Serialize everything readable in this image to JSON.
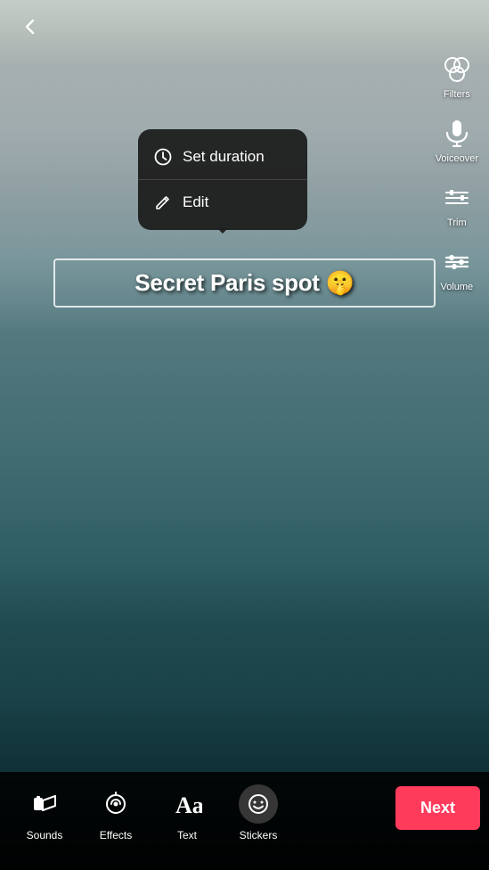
{
  "video": {
    "alt": "Paris river video background"
  },
  "top_bar": {
    "back_label": "‹"
  },
  "right_toolbar": {
    "items": [
      {
        "id": "filters",
        "label": "Filters",
        "icon": "filters"
      },
      {
        "id": "voiceover",
        "label": "Voiceover",
        "icon": "mic"
      },
      {
        "id": "trim",
        "label": "Trim",
        "icon": "trim"
      },
      {
        "id": "volume",
        "label": "Volume",
        "icon": "sliders"
      }
    ]
  },
  "context_menu": {
    "items": [
      {
        "id": "set-duration",
        "label": "Set duration",
        "icon": "clock"
      },
      {
        "id": "edit",
        "label": "Edit",
        "icon": "edit"
      }
    ]
  },
  "text_overlay": {
    "content": "Secret Paris spot 🤫"
  },
  "bottom_toolbar": {
    "tools": [
      {
        "id": "sounds",
        "label": "Sounds",
        "icon": "music"
      },
      {
        "id": "effects",
        "label": "Effects",
        "icon": "effects"
      },
      {
        "id": "text",
        "label": "Text",
        "icon": "text"
      },
      {
        "id": "stickers",
        "label": "Stickers",
        "icon": "sticker"
      }
    ],
    "next_button": "Next"
  }
}
